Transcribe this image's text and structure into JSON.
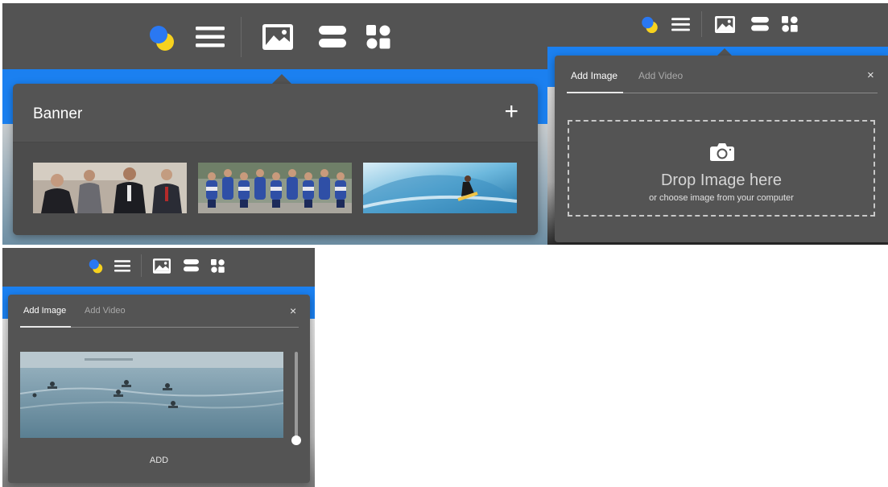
{
  "colors": {
    "toolbar_bg": "#535353",
    "dialog_bg": "#545454",
    "accent_blue": "#1b80f0",
    "logo_blue": "#2a78f2",
    "logo_yellow": "#f7d21e",
    "text_light": "#ffffff",
    "text_muted": "#a9a9a9"
  },
  "toolbar_icons": [
    "logo-icon",
    "menu-icon",
    "image-icon",
    "sections-icon",
    "widgets-icon"
  ],
  "banner_panel": {
    "title": "Banner",
    "add_symbol": "+",
    "thumbnails": [
      {
        "name": "people-meeting"
      },
      {
        "name": "cycling-team"
      },
      {
        "name": "surfer-wave"
      }
    ]
  },
  "upload_panel": {
    "tabs": {
      "add_image": "Add Image",
      "add_video": "Add Video"
    },
    "active_tab": "Add Image",
    "close_symbol": "×",
    "drop_title": "Drop Image here",
    "drop_subtitle": "or choose image from your computer"
  },
  "preview_panel": {
    "tabs": {
      "add_image": "Add Image",
      "add_video": "Add Video"
    },
    "active_tab": "Add Image",
    "close_symbol": "×",
    "add_label": "ADD",
    "scroll_position": 1.0
  }
}
